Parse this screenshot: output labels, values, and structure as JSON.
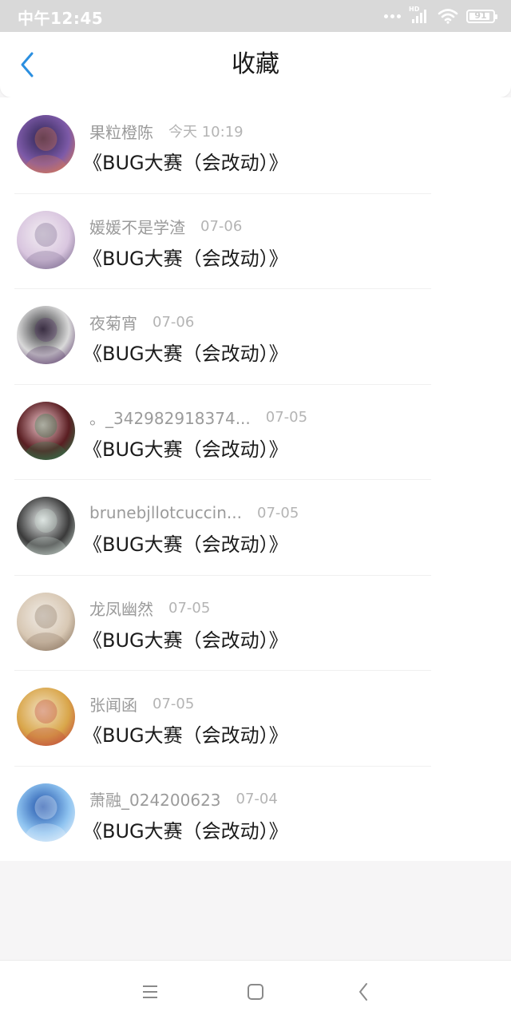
{
  "status_bar": {
    "time": "中午12:45",
    "network_label": "HD",
    "battery": "91",
    "battery_level": 0.91
  },
  "header": {
    "title": "收藏",
    "back_icon": "chevron-left-icon"
  },
  "favorites": [
    {
      "author": "果粒橙陈",
      "date": "今天 10:19",
      "title": "《BUG大赛（会改动）》",
      "avatar_colors": [
        "#2b2350",
        "#7d5aa8",
        "#e07b50"
      ]
    },
    {
      "author": "媛媛不是学渣",
      "date": "07-06",
      "title": "《BUG大赛（会改动）》",
      "avatar_colors": [
        "#f3eef3",
        "#d9c6df",
        "#7b6a8e"
      ]
    },
    {
      "author": "夜菊宵",
      "date": "07-06",
      "title": "《BUG大赛（会改动）》",
      "avatar_colors": [
        "#2a2a2e",
        "#d9d9d9",
        "#5a3a6a"
      ]
    },
    {
      "author": "。_342982918374...",
      "date": "07-05",
      "title": "《BUG大赛（会改动）》",
      "avatar_colors": [
        "#f2c9cf",
        "#5a1e22",
        "#2e7d4f"
      ]
    },
    {
      "author": "brunebjllotcuccin...",
      "date": "07-05",
      "title": "《BUG大赛（会改动）》",
      "avatar_colors": [
        "#e8ecec",
        "#3a3a3a",
        "#c9d6cf"
      ]
    },
    {
      "author": "龙凤幽然",
      "date": "07-05",
      "title": "《BUG大赛（会改动）》",
      "avatar_colors": [
        "#f1ece6",
        "#d8c8b4",
        "#8a7560"
      ]
    },
    {
      "author": "张闻函",
      "date": "07-05",
      "title": "《BUG大赛（会改动）》",
      "avatar_colors": [
        "#f2e2c4",
        "#d9a64a",
        "#c0453a"
      ]
    },
    {
      "author": "萧融_024200623",
      "date": "07-04",
      "title": "《BUG大赛（会改动）》",
      "avatar_colors": [
        "#1d4fa8",
        "#8ec3f0",
        "#e8f2fb"
      ]
    }
  ],
  "nav_bar": {
    "icons": [
      "menu-icon",
      "home-square-icon",
      "back-triangle-icon"
    ]
  }
}
